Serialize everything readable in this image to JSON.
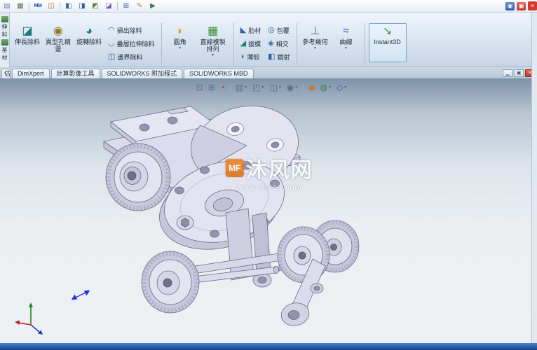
{
  "colors": {
    "accent": "#2d5fa8",
    "statusbar_top": "#4a7fd4",
    "statusbar_bottom": "#17407f",
    "watermark_orange": "#f08519",
    "viewport_top": "#7e92a8",
    "viewport_bottom": "#eef1f4",
    "close_red": "#d23b2e"
  },
  "glyphs": {
    "dropdown": "▼"
  },
  "top_toolbar": {
    "icons": [
      {
        "name": "document-icon",
        "glyph": "▤",
        "color": "#6b8cb5"
      },
      {
        "name": "snapshot-icon",
        "glyph": "▦",
        "color": "#4f7d52"
      },
      {
        "name": "measure-icon",
        "glyph": "MM",
        "color": "#1f4f9e"
      },
      {
        "name": "section-icon",
        "glyph": "◫",
        "color": "#b86a28"
      },
      {
        "name": "view-cube-icon",
        "glyph": "◧",
        "color": "#2d5fa8"
      },
      {
        "name": "wireframe-icon",
        "glyph": "◨",
        "color": "#2d5fa8"
      },
      {
        "name": "shaded-icon",
        "glyph": "◩",
        "color": "#5a7d3a"
      },
      {
        "name": "perspective-icon",
        "glyph": "◪",
        "color": "#7a5aa0"
      },
      {
        "name": "pattern-icon",
        "glyph": "⊞",
        "color": "#2d5fa8"
      },
      {
        "name": "annotation-icon",
        "glyph": "✎",
        "color": "#b8902d"
      },
      {
        "name": "macro-icon",
        "glyph": "▶",
        "color": "#3f7a4a"
      }
    ],
    "right_icons": [
      {
        "name": "app-window-icon",
        "glyph": "▣"
      },
      {
        "name": "alert-window-icon",
        "glyph": "▣"
      }
    ],
    "close_glyph": "×"
  },
  "left_strip": {
    "chars": [
      "伸",
      "料",
      "基",
      "材"
    ]
  },
  "ribbon": {
    "buttons": {
      "extruded_cut": {
        "label": "伸長除料",
        "glyph": "◪",
        "color": "#1f7a7a"
      },
      "hole_wizard": {
        "label": "異型孔精靈",
        "glyph": "◉",
        "color": "#8a7a2d"
      },
      "revolved_cut": {
        "label": "旋轉除料",
        "glyph": "◕",
        "color": "#1f7a7a"
      },
      "swept_cut": {
        "label": "掃出除料",
        "glyph": "◠",
        "color": "#2d5fa8"
      },
      "lofted_cut": {
        "label": "疊層拉伸除料",
        "glyph": "◡",
        "color": "#2d5fa8"
      },
      "boundary_cut": {
        "label": "邊界除料",
        "glyph": "◫",
        "color": "#2d5fa8"
      },
      "fillet": {
        "label": "圓角",
        "glyph": "◗",
        "color": "#d9a21b"
      },
      "linear_pattern": {
        "label": "直線複製排列",
        "glyph": "▦",
        "color": "#3f8a3f"
      },
      "rib": {
        "label": "肋材",
        "glyph": "◣",
        "color": "#2d5fa8"
      },
      "draft": {
        "label": "拔模",
        "glyph": "◢",
        "color": "#1f7a7a"
      },
      "shell": {
        "label": "薄殼",
        "glyph": "◖",
        "color": "#2d5fa8"
      },
      "wrap": {
        "label": "包覆",
        "glyph": "◎",
        "color": "#2d5fa8"
      },
      "intersect": {
        "label": "相交",
        "glyph": "◈",
        "color": "#2d5fa8"
      },
      "mirror": {
        "label": "鏡射",
        "glyph": "◧",
        "color": "#2d5fa8"
      },
      "reference_geometry": {
        "label": "參考幾何",
        "glyph": "⊥",
        "color": "#5a6e84"
      },
      "curves": {
        "label": "曲線",
        "glyph": "≈",
        "color": "#2d5fa8"
      },
      "instant3d": {
        "label": "Instant3D",
        "glyph": "↘",
        "color": "#3f8a3f"
      }
    }
  },
  "tabs": [
    {
      "label": "估"
    },
    {
      "label": "DimXpert"
    },
    {
      "label": "計算影像工具"
    },
    {
      "label": "SOLIDWORKS 附加程式"
    },
    {
      "label": "SOLIDWORKS MBD"
    }
  ],
  "doc_window_controls": {
    "minimize": "▁",
    "restore": "▣",
    "close": "×"
  },
  "hud": {
    "icons": [
      {
        "name": "zoom-fit-icon",
        "glyph": "⊡",
        "color": "#5a6e84",
        "arrow": false
      },
      {
        "name": "zoom-area-icon",
        "glyph": "⊞",
        "color": "#5a6e84",
        "arrow": false
      },
      {
        "name": "previous-view-icon",
        "glyph": "◔",
        "color": "#b03a3a",
        "arrow": false
      },
      {
        "name": "section-view-icon",
        "glyph": "▥",
        "color": "#5a6e84",
        "arrow": true
      },
      {
        "name": "view-orientation-icon",
        "glyph": "◰",
        "color": "#5a6e84",
        "arrow": true
      },
      {
        "name": "display-style-icon",
        "glyph": "◫",
        "color": "#5a6e84",
        "arrow": true
      },
      {
        "name": "hide-show-icon",
        "glyph": "◉",
        "color": "#5a6e84",
        "arrow": true
      },
      {
        "name": "edit-appearance-icon",
        "glyph": "◆",
        "color": "#c8772a",
        "arrow": false
      },
      {
        "name": "apply-scene-icon",
        "glyph": "◍",
        "color": "#3f7a4a",
        "arrow": true
      },
      {
        "name": "view-settings-icon",
        "glyph": "◇",
        "color": "#2d5fa8",
        "arrow": true
      }
    ]
  },
  "watermark": {
    "logo_text": "MF",
    "title": "沐风网",
    "url": "www.mfcad.com"
  },
  "status_bar": {
    "text": ""
  }
}
